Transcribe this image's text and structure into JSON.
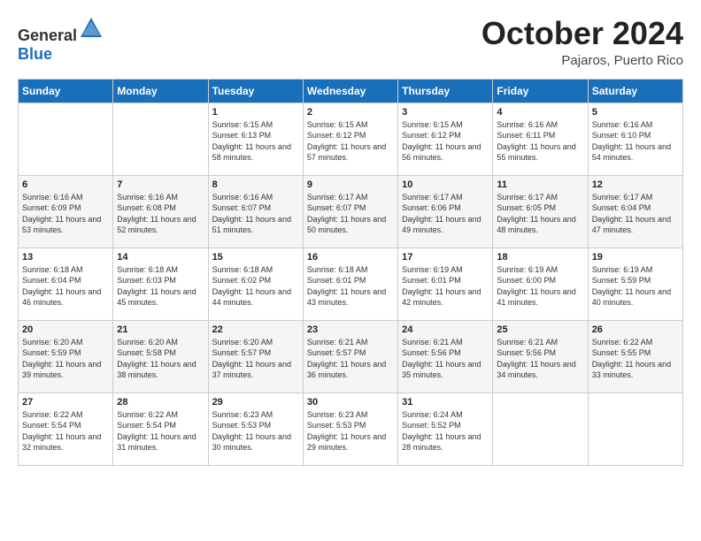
{
  "header": {
    "logo_general": "General",
    "logo_blue": "Blue",
    "month": "October 2024",
    "location": "Pajaros, Puerto Rico"
  },
  "days_of_week": [
    "Sunday",
    "Monday",
    "Tuesday",
    "Wednesday",
    "Thursday",
    "Friday",
    "Saturday"
  ],
  "weeks": [
    [
      {
        "day": "",
        "sunrise": "",
        "sunset": "",
        "daylight": ""
      },
      {
        "day": "",
        "sunrise": "",
        "sunset": "",
        "daylight": ""
      },
      {
        "day": "1",
        "sunrise": "Sunrise: 6:15 AM",
        "sunset": "Sunset: 6:13 PM",
        "daylight": "Daylight: 11 hours and 58 minutes."
      },
      {
        "day": "2",
        "sunrise": "Sunrise: 6:15 AM",
        "sunset": "Sunset: 6:12 PM",
        "daylight": "Daylight: 11 hours and 57 minutes."
      },
      {
        "day": "3",
        "sunrise": "Sunrise: 6:15 AM",
        "sunset": "Sunset: 6:12 PM",
        "daylight": "Daylight: 11 hours and 56 minutes."
      },
      {
        "day": "4",
        "sunrise": "Sunrise: 6:16 AM",
        "sunset": "Sunset: 6:11 PM",
        "daylight": "Daylight: 11 hours and 55 minutes."
      },
      {
        "day": "5",
        "sunrise": "Sunrise: 6:16 AM",
        "sunset": "Sunset: 6:10 PM",
        "daylight": "Daylight: 11 hours and 54 minutes."
      }
    ],
    [
      {
        "day": "6",
        "sunrise": "Sunrise: 6:16 AM",
        "sunset": "Sunset: 6:09 PM",
        "daylight": "Daylight: 11 hours and 53 minutes."
      },
      {
        "day": "7",
        "sunrise": "Sunrise: 6:16 AM",
        "sunset": "Sunset: 6:08 PM",
        "daylight": "Daylight: 11 hours and 52 minutes."
      },
      {
        "day": "8",
        "sunrise": "Sunrise: 6:16 AM",
        "sunset": "Sunset: 6:07 PM",
        "daylight": "Daylight: 11 hours and 51 minutes."
      },
      {
        "day": "9",
        "sunrise": "Sunrise: 6:17 AM",
        "sunset": "Sunset: 6:07 PM",
        "daylight": "Daylight: 11 hours and 50 minutes."
      },
      {
        "day": "10",
        "sunrise": "Sunrise: 6:17 AM",
        "sunset": "Sunset: 6:06 PM",
        "daylight": "Daylight: 11 hours and 49 minutes."
      },
      {
        "day": "11",
        "sunrise": "Sunrise: 6:17 AM",
        "sunset": "Sunset: 6:05 PM",
        "daylight": "Daylight: 11 hours and 48 minutes."
      },
      {
        "day": "12",
        "sunrise": "Sunrise: 6:17 AM",
        "sunset": "Sunset: 6:04 PM",
        "daylight": "Daylight: 11 hours and 47 minutes."
      }
    ],
    [
      {
        "day": "13",
        "sunrise": "Sunrise: 6:18 AM",
        "sunset": "Sunset: 6:04 PM",
        "daylight": "Daylight: 11 hours and 46 minutes."
      },
      {
        "day": "14",
        "sunrise": "Sunrise: 6:18 AM",
        "sunset": "Sunset: 6:03 PM",
        "daylight": "Daylight: 11 hours and 45 minutes."
      },
      {
        "day": "15",
        "sunrise": "Sunrise: 6:18 AM",
        "sunset": "Sunset: 6:02 PM",
        "daylight": "Daylight: 11 hours and 44 minutes."
      },
      {
        "day": "16",
        "sunrise": "Sunrise: 6:18 AM",
        "sunset": "Sunset: 6:01 PM",
        "daylight": "Daylight: 11 hours and 43 minutes."
      },
      {
        "day": "17",
        "sunrise": "Sunrise: 6:19 AM",
        "sunset": "Sunset: 6:01 PM",
        "daylight": "Daylight: 11 hours and 42 minutes."
      },
      {
        "day": "18",
        "sunrise": "Sunrise: 6:19 AM",
        "sunset": "Sunset: 6:00 PM",
        "daylight": "Daylight: 11 hours and 41 minutes."
      },
      {
        "day": "19",
        "sunrise": "Sunrise: 6:19 AM",
        "sunset": "Sunset: 5:59 PM",
        "daylight": "Daylight: 11 hours and 40 minutes."
      }
    ],
    [
      {
        "day": "20",
        "sunrise": "Sunrise: 6:20 AM",
        "sunset": "Sunset: 5:59 PM",
        "daylight": "Daylight: 11 hours and 39 minutes."
      },
      {
        "day": "21",
        "sunrise": "Sunrise: 6:20 AM",
        "sunset": "Sunset: 5:58 PM",
        "daylight": "Daylight: 11 hours and 38 minutes."
      },
      {
        "day": "22",
        "sunrise": "Sunrise: 6:20 AM",
        "sunset": "Sunset: 5:57 PM",
        "daylight": "Daylight: 11 hours and 37 minutes."
      },
      {
        "day": "23",
        "sunrise": "Sunrise: 6:21 AM",
        "sunset": "Sunset: 5:57 PM",
        "daylight": "Daylight: 11 hours and 36 minutes."
      },
      {
        "day": "24",
        "sunrise": "Sunrise: 6:21 AM",
        "sunset": "Sunset: 5:56 PM",
        "daylight": "Daylight: 11 hours and 35 minutes."
      },
      {
        "day": "25",
        "sunrise": "Sunrise: 6:21 AM",
        "sunset": "Sunset: 5:56 PM",
        "daylight": "Daylight: 11 hours and 34 minutes."
      },
      {
        "day": "26",
        "sunrise": "Sunrise: 6:22 AM",
        "sunset": "Sunset: 5:55 PM",
        "daylight": "Daylight: 11 hours and 33 minutes."
      }
    ],
    [
      {
        "day": "27",
        "sunrise": "Sunrise: 6:22 AM",
        "sunset": "Sunset: 5:54 PM",
        "daylight": "Daylight: 11 hours and 32 minutes."
      },
      {
        "day": "28",
        "sunrise": "Sunrise: 6:22 AM",
        "sunset": "Sunset: 5:54 PM",
        "daylight": "Daylight: 11 hours and 31 minutes."
      },
      {
        "day": "29",
        "sunrise": "Sunrise: 6:23 AM",
        "sunset": "Sunset: 5:53 PM",
        "daylight": "Daylight: 11 hours and 30 minutes."
      },
      {
        "day": "30",
        "sunrise": "Sunrise: 6:23 AM",
        "sunset": "Sunset: 5:53 PM",
        "daylight": "Daylight: 11 hours and 29 minutes."
      },
      {
        "day": "31",
        "sunrise": "Sunrise: 6:24 AM",
        "sunset": "Sunset: 5:52 PM",
        "daylight": "Daylight: 11 hours and 28 minutes."
      },
      {
        "day": "",
        "sunrise": "",
        "sunset": "",
        "daylight": ""
      },
      {
        "day": "",
        "sunrise": "",
        "sunset": "",
        "daylight": ""
      }
    ]
  ]
}
